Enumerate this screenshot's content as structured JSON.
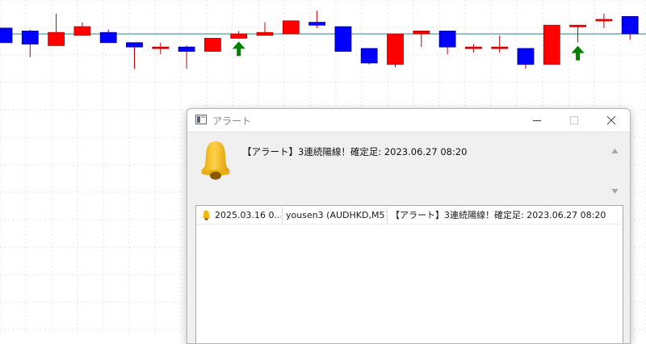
{
  "chart": {
    "background": "#ffffff",
    "grid_color": "#e6e6e6",
    "bull_color": "#ff0000",
    "bear_color": "#0000ff",
    "wick_color": "#c00000",
    "level_line_color": "#1e8c8c",
    "arrow_color": "#008000",
    "level_price": 0.0,
    "candles": [
      {
        "o": 0.4,
        "c": -0.6,
        "h": 0.4,
        "l": -0.6
      },
      {
        "o": 0.2,
        "c": -0.7,
        "h": 0.3,
        "l": -1.6
      },
      {
        "o": -0.8,
        "c": 0.1,
        "h": 1.4,
        "l": -0.8
      },
      {
        "o": -0.1,
        "c": 0.5,
        "h": 0.8,
        "l": -0.1
      },
      {
        "o": 0.1,
        "c": -0.6,
        "h": 0.3,
        "l": -0.6
      },
      {
        "o": -0.6,
        "c": -0.9,
        "h": -0.6,
        "l": -2.4
      },
      {
        "o": -0.9,
        "c": -0.9,
        "h": -0.6,
        "l": -1.4
      },
      {
        "o": -0.9,
        "c": -1.2,
        "h": -0.8,
        "l": -2.4
      },
      {
        "o": -1.2,
        "c": -0.3,
        "h": -0.3,
        "l": -1.2
      },
      {
        "o": -0.3,
        "c": 0.0,
        "h": -0.3,
        "l": 0.2
      },
      {
        "o": -0.1,
        "c": 0.1,
        "h": 0.8,
        "l": -0.1
      },
      {
        "o": 0.0,
        "c": 0.9,
        "h": 0.9,
        "l": 0.0
      },
      {
        "o": 0.8,
        "c": 0.6,
        "h": 1.6,
        "l": 0.4
      },
      {
        "o": 0.5,
        "c": -1.2,
        "h": 0.5,
        "l": -1.2
      },
      {
        "o": -1.0,
        "c": -2.0,
        "h": -1.0,
        "l": -2.1
      },
      {
        "o": -2.1,
        "c": 0.0,
        "h": 0.0,
        "l": -2.3
      },
      {
        "o": 0.0,
        "c": 0.2,
        "h": 0.2,
        "l": -0.9
      },
      {
        "o": 0.2,
        "c": -0.9,
        "h": 0.2,
        "l": -1.4
      },
      {
        "o": -0.9,
        "c": -0.9,
        "h": -0.7,
        "l": -1.3
      },
      {
        "o": -0.9,
        "c": -0.9,
        "h": -0.1,
        "l": -1.3
      },
      {
        "o": -1.0,
        "c": -2.1,
        "h": -1.0,
        "l": -2.4
      },
      {
        "o": -2.1,
        "c": 0.6,
        "h": 0.6,
        "l": -2.1
      },
      {
        "o": 0.5,
        "c": 0.6,
        "h": 0.6,
        "l": -0.6
      },
      {
        "o": 1.0,
        "c": 1.0,
        "h": 1.4,
        "l": 0.4
      },
      {
        "o": 1.2,
        "c": 0.0,
        "h": 1.2,
        "l": -0.4
      }
    ],
    "up_arrows": [
      9,
      22
    ]
  },
  "window": {
    "title": "アラート",
    "message": "【アラート】3連続陽線！確定足: 2023.06.27 08:20",
    "controls": {
      "minimize": "minimize",
      "maximize": "maximize",
      "close": "close"
    }
  },
  "alerts": [
    {
      "time": "2025.03.16 0...",
      "expert": "yousen3 (AUDHKD,M5)",
      "message": "【アラート】3連続陽線！確定足: 2023.06.27 08:20"
    }
  ]
}
